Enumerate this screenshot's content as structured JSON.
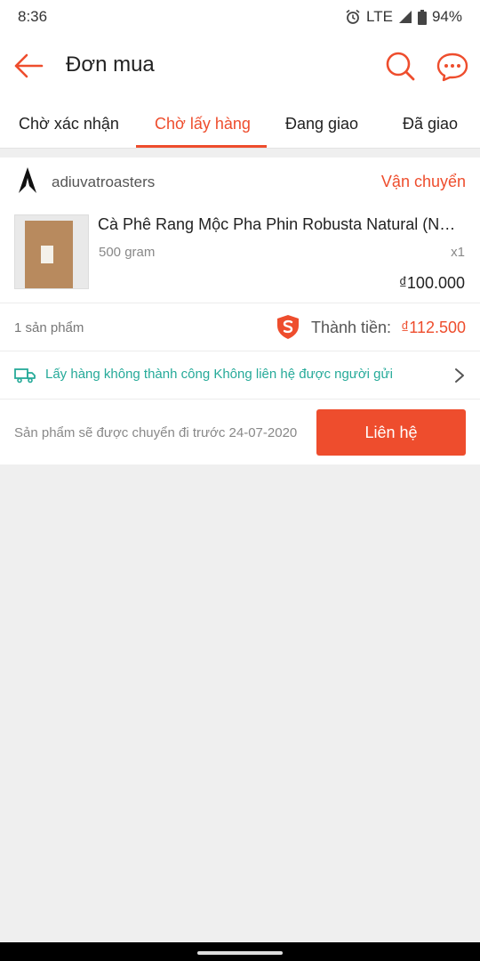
{
  "status_bar": {
    "time": "8:36",
    "network": "LTE",
    "battery": "94%"
  },
  "header": {
    "title": "Đơn mua"
  },
  "tabs": [
    {
      "label": "Chờ xác nhận",
      "active": false
    },
    {
      "label": "Chờ lấy hàng",
      "active": true
    },
    {
      "label": "Đang giao",
      "active": false
    },
    {
      "label": "Đã giao",
      "active": false
    }
  ],
  "order": {
    "shop_name": "adiuvatroasters",
    "shipping_status": "Vận chuyển",
    "product": {
      "name": "Cà Phê Rang Mộc Pha Phin Robusta Natural (Ng…",
      "variant": "500 gram",
      "quantity": "x1",
      "price": "₫100.000"
    },
    "item_count": "1 sản phẩm",
    "total_label": "Thành tiền:",
    "total_value": "₫112.500",
    "delivery_message": "Lấy hàng không thành công Không liên hệ được người gửi",
    "delivery_note": "Sản phẩm sẽ được chuyển đi trước 24-07-2020",
    "contact_button": "Liên hệ"
  },
  "colors": {
    "accent": "#ee4d2d",
    "teal": "#26aa99"
  }
}
